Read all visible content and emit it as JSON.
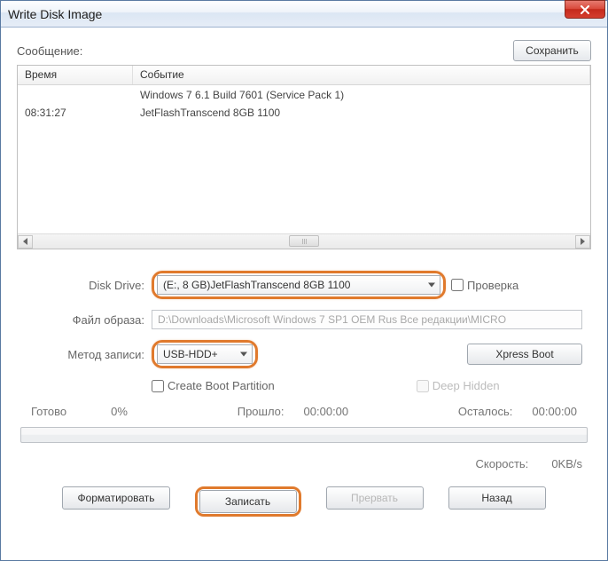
{
  "window": {
    "title": "Write Disk Image"
  },
  "message": {
    "label": "Сообщение:",
    "save_btn": "Сохранить"
  },
  "log": {
    "col_time": "Время",
    "col_event": "Событие",
    "rows": [
      {
        "time": "",
        "event": "Windows 7 6.1 Build 7601 (Service Pack 1)"
      },
      {
        "time": "08:31:27",
        "event": "JetFlashTranscend 8GB   1100"
      }
    ]
  },
  "form": {
    "disk_drive_label": "Disk Drive:",
    "disk_drive_value": "(E:, 8 GB)JetFlashTranscend 8GB   1100",
    "verify_label": "Проверка",
    "image_label": "Файл образа:",
    "image_value": "D:\\Downloads\\Microsoft Windows 7 SP1 OEM Rus Все редакции\\MICRO",
    "method_label": "Метод записи:",
    "method_value": "USB-HDD+",
    "xpress_btn": "Xpress Boot",
    "cbp_label": "Create Boot Partition",
    "deep_label": "Deep Hidden"
  },
  "status": {
    "ready": "Готово",
    "pct": "0%",
    "elapsed_label": "Прошло:",
    "elapsed": "00:00:00",
    "remain_label": "Осталось:",
    "remain": "00:00:00"
  },
  "speed": {
    "label": "Скорость:",
    "value": "0KB/s"
  },
  "buttons": {
    "format": "Форматировать",
    "write": "Записать",
    "abort": "Прервать",
    "back": "Назад"
  }
}
